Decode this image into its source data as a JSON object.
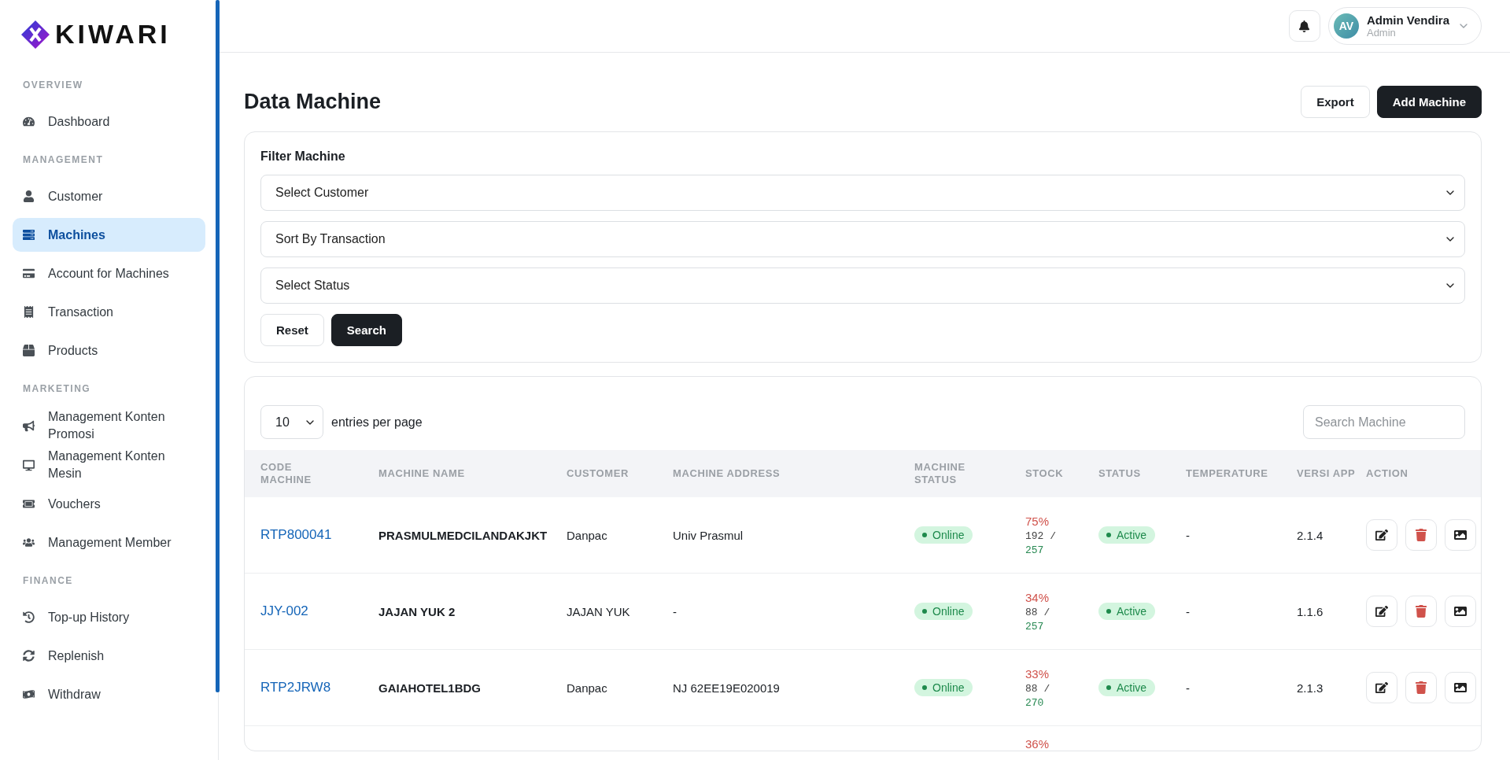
{
  "brand": {
    "name": "KIWARI"
  },
  "sidebar": {
    "sections": [
      {
        "title": "OVERVIEW",
        "items": [
          {
            "label": "Dashboard",
            "selected": false
          }
        ]
      },
      {
        "title": "MANAGEMENT",
        "items": [
          {
            "label": "Customer",
            "selected": false
          },
          {
            "label": "Machines",
            "selected": true
          },
          {
            "label": "Account for Machines",
            "selected": false
          },
          {
            "label": "Transaction",
            "selected": false
          },
          {
            "label": "Products",
            "selected": false
          }
        ]
      },
      {
        "title": "MARKETING",
        "items": [
          {
            "label": "Management Konten Promosi",
            "selected": false
          },
          {
            "label": "Management Konten Mesin",
            "selected": false
          },
          {
            "label": "Vouchers",
            "selected": false
          },
          {
            "label": "Management Member",
            "selected": false
          }
        ]
      },
      {
        "title": "FINANCE",
        "items": [
          {
            "label": "Top-up History",
            "selected": false
          },
          {
            "label": "Replenish",
            "selected": false
          },
          {
            "label": "Withdraw",
            "selected": false
          }
        ]
      }
    ]
  },
  "user": {
    "initials": "AV",
    "name": "Admin Vendira",
    "role": "Admin"
  },
  "page": {
    "title": "Data Machine",
    "buttons": [
      {
        "label": "Export",
        "kind": "outline"
      },
      {
        "label": "Add Machine",
        "kind": "primary"
      }
    ]
  },
  "filter": {
    "title": "Filter Machine",
    "selects": [
      "Select Customer",
      "Sort By Transaction",
      "Select Status"
    ],
    "buttons": [
      {
        "label": "Reset",
        "kind": "outline"
      },
      {
        "label": "Search",
        "kind": "primary"
      }
    ]
  },
  "table": {
    "page_size": "10",
    "page_size_label": "entries per page",
    "search": {
      "placeholder": "Search Machine"
    },
    "columns": [
      "CODE MACHINE",
      "MACHINE NAME",
      "CUSTOMER",
      "MACHINE ADDRESS",
      "MACHINE STATUS",
      "STOCK",
      "STATUS",
      "TEMPERATURE",
      "VERSI APP",
      "ACTION"
    ],
    "rows": [
      {
        "code": "RTP800041",
        "name": "PRASMULMEDCILANDAKJKT",
        "customer": "Danpac",
        "address": "Univ Prasmul",
        "machine_status": "Online",
        "stock_percent": "75%",
        "stock_count": "192 /",
        "stock_capacity": "257",
        "status": "Active",
        "temperature": "-",
        "version": "2.1.4"
      },
      {
        "code": "JJY-002",
        "name": "JAJAN YUK 2",
        "customer": "JAJAN YUK",
        "address": "-",
        "machine_status": "Online",
        "stock_percent": "34%",
        "stock_count": "88 /",
        "stock_capacity": "257",
        "status": "Active",
        "temperature": "-",
        "version": "1.1.6"
      },
      {
        "code": "RTP2JRW8",
        "name": "GAIAHOTEL1BDG",
        "customer": "Danpac",
        "address": "NJ 62EE19E020019",
        "machine_status": "Online",
        "stock_percent": "33%",
        "stock_count": "88 /",
        "stock_capacity": "270",
        "status": "Active",
        "temperature": "-",
        "version": "2.1.3"
      },
      {
        "stock_percent": "36%"
      }
    ]
  }
}
